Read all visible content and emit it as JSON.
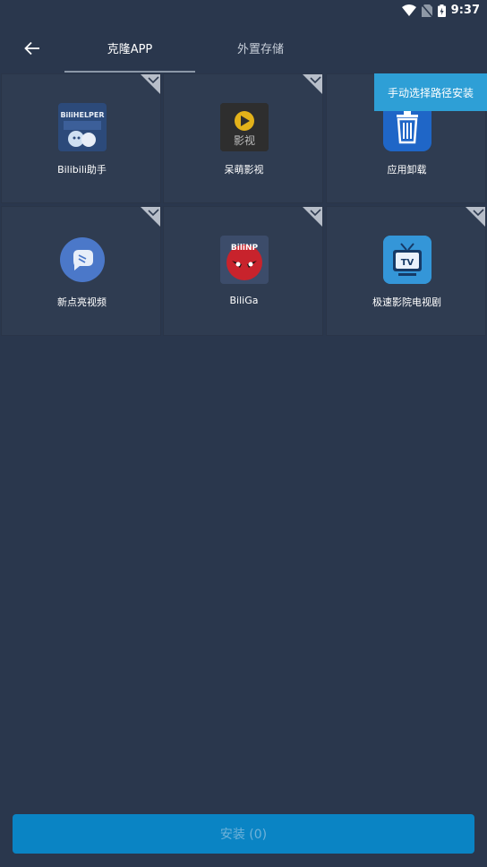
{
  "status": {
    "time": "9:37"
  },
  "header": {
    "tabs": [
      {
        "label": "克隆APP"
      },
      {
        "label": "外置存储"
      }
    ]
  },
  "manual_button": {
    "label": "手动选择路径安装"
  },
  "apps": [
    {
      "name": "Bilibili助手",
      "icon": "bilihelper-icon"
    },
    {
      "name": "呆萌影视",
      "icon": "play-video-icon"
    },
    {
      "name": "应用卸载",
      "icon": "trash-icon"
    },
    {
      "name": "新点亮视频",
      "icon": "chat-bubble-icon"
    },
    {
      "name": "BiliGa",
      "icon": "bilinp-mascot-icon"
    },
    {
      "name": "极速影院电视剧",
      "icon": "tv-icon"
    }
  ],
  "install_button": {
    "label": "安装 (0)"
  },
  "icon_text": {
    "bilihelper": "BiliHELPER",
    "yingshi": "影视",
    "bilinp": "BiliNP",
    "tv": "TV"
  },
  "colors": {
    "background": "#2a374d",
    "cell": "#2f3c51",
    "accent": "#2e9fd6",
    "install": "#0a84c4"
  }
}
